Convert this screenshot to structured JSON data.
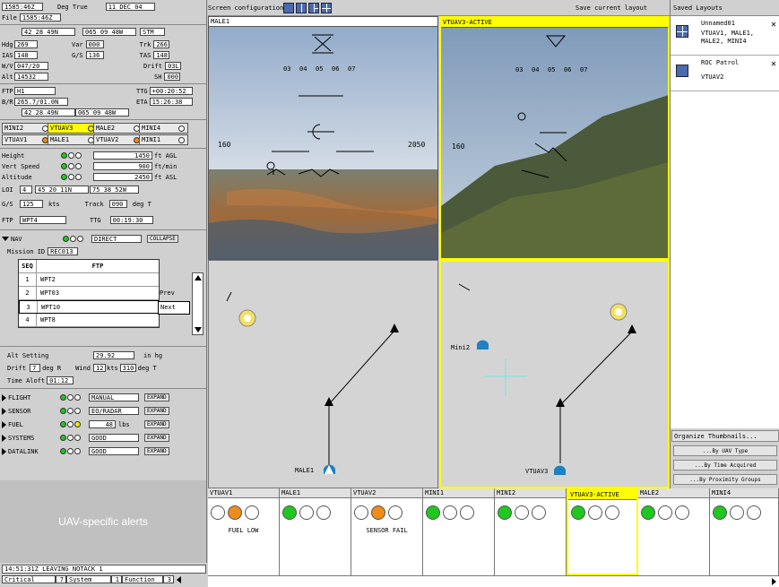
{
  "left": {
    "top_row": {
      "coords": "1585:46Z",
      "deg": "Deg True",
      "date": "11 DEC 04"
    },
    "file": {
      "label": "File",
      "value": "1585:46Z"
    },
    "pos1": {
      "lat": "42 28 49N",
      "lon": "065 09 48W",
      "stm": "STM"
    },
    "hdg": {
      "label": "Hdg",
      "value": "269"
    },
    "var": {
      "label": "Var",
      "value": "000"
    },
    "trk": {
      "label": "Trk",
      "value": "266"
    },
    "ias": {
      "label": "IAS",
      "value": "148"
    },
    "gs": {
      "label": "G/S",
      "value": "136"
    },
    "tas": {
      "label": "TAS",
      "value": "148"
    },
    "wv": {
      "label": "W/V",
      "value": "047/20"
    },
    "drift": {
      "label": "Drift",
      "value": "03L"
    },
    "alt": {
      "label": "Alt",
      "value": "14532"
    },
    "sh": {
      "label": "SH",
      "value": "000"
    },
    "ftp": {
      "label": "FTP",
      "value": "H1"
    },
    "ttg": {
      "label": "TTG",
      "value": "+00:20:52"
    },
    "br": {
      "label": "B/R",
      "value": "265.7/01.0N"
    },
    "eta": {
      "label": "ETA",
      "value": "15:26:38"
    },
    "pos2": {
      "lat": "42 28 49N",
      "lon": "065 09 48W"
    },
    "uavs": [
      {
        "name": "MINI2",
        "sel": false,
        "led": ""
      },
      {
        "name": "VTUAV3",
        "sel": true,
        "led": "y"
      },
      {
        "name": "MALE2",
        "sel": false,
        "led": ""
      },
      {
        "name": "MINI4",
        "sel": false,
        "led": ""
      },
      {
        "name": "VTUAV1",
        "sel": false,
        "led": "o"
      },
      {
        "name": "MALE1",
        "sel": false,
        "led": ""
      },
      {
        "name": "VTUAV2",
        "sel": false,
        "led": "o"
      },
      {
        "name": "MINI1",
        "sel": false,
        "led": ""
      }
    ],
    "height": {
      "label": "Height",
      "value": "1450",
      "unit": "ft AGL"
    },
    "vspeed": {
      "label": "Vert Speed",
      "value": "900",
      "unit": "ft/min"
    },
    "altitude": {
      "label": "Altitude",
      "value": "2450",
      "unit": "ft ASL"
    },
    "loi": {
      "label": "LOI",
      "num": "4",
      "lat": "45 20 11N",
      "lon": "75 38 52W"
    },
    "gs2": {
      "label": "G/S",
      "value": "125",
      "unit": "kts",
      "track_label": "Track",
      "track": "090",
      "track_unit": "deg T"
    },
    "ftp2": {
      "label": "FTP",
      "value": "WPT4",
      "ttg_label": "TTG",
      "ttg": "00:19:30"
    },
    "nav": {
      "label": "NAV",
      "mode": "DIRECT",
      "btn": "COLLAPSE"
    },
    "mission": {
      "label": "Mission ID",
      "value": "REC013"
    },
    "fptable": {
      "hdr_seq": "SEQ",
      "hdr_ftp": "FTP",
      "rows": [
        {
          "seq": "1",
          "wpt": "WPT2",
          "tag": ""
        },
        {
          "seq": "2",
          "wpt": "WPT03",
          "tag": "Prev"
        },
        {
          "seq": "3",
          "wpt": "WPT10",
          "tag": "Next"
        },
        {
          "seq": "4",
          "wpt": "WPT8",
          "tag": ""
        }
      ]
    },
    "altset": {
      "label": "Alt Setting",
      "value": "29.92",
      "unit": "in hg"
    },
    "drift2": {
      "label": "Drift",
      "value": "7",
      "unit": "deg R",
      "wind_label": "Wind",
      "wind": "12",
      "wind_unit": "kts",
      "wind_dir": "310",
      "wind_dir_unit": "deg T"
    },
    "timealoft": {
      "label": "Time Aloft",
      "value": "01:12"
    },
    "systems": [
      {
        "name": "FLIGHT",
        "value": "MANUAL",
        "unit": "",
        "leds": [
          "g",
          "",
          ""
        ],
        "btn": "EXPAND"
      },
      {
        "name": "SENSOR",
        "value": "EO/RADAR",
        "unit": "",
        "leds": [
          "g",
          "",
          ""
        ],
        "btn": "EXPAND"
      },
      {
        "name": "FUEL",
        "value": "48",
        "unit": "lbs",
        "leds": [
          "g",
          "",
          "y"
        ],
        "btn": "EXPAND"
      },
      {
        "name": "SYSTEMS",
        "value": "GOOD",
        "unit": "",
        "leds": [
          "g",
          "",
          ""
        ],
        "btn": "EXPAND"
      },
      {
        "name": "DATALINK",
        "value": "GOOD",
        "unit": "",
        "leds": [
          "g",
          "",
          ""
        ],
        "btn": "EXPAND"
      }
    ],
    "alerts_label": "UAV-specific alerts",
    "status_msg": "14:51:31Z LEAVING NOTACK 1",
    "counts": {
      "critical_label": "Critical",
      "critical": "7",
      "system_label": "System",
      "system": "1",
      "function_label": "Function",
      "function": "3"
    }
  },
  "top": {
    "screen_config": "Screen configuration:",
    "save_layout": "Save current layout"
  },
  "views": {
    "male1": "MALE1",
    "vtuav3": "VTUAV3-ACTIVE",
    "hud": {
      "heads": [
        "03",
        "04",
        "05",
        "06",
        "07"
      ],
      "speed": "160",
      "alt": "2050"
    },
    "map_labels": {
      "mini2": "Mini2",
      "male1": "MALE1",
      "vtuav3": "VTUAV3"
    }
  },
  "right": {
    "title": "Saved Layouts",
    "layouts": [
      {
        "name": "Unnamed01",
        "desc": "VTUAV1, MALE1, MALE2, MINI4"
      },
      {
        "name": "ROC Patrol",
        "desc": "VTUAV2"
      }
    ],
    "organize": "Organize Thumbnails...",
    "by_type": "...By UAV Type",
    "by_time": "...By Time Acquired",
    "by_prox": "...By Proximity Groups"
  },
  "thumbs": [
    {
      "name": "VTUAV1",
      "leds": [
        "",
        "o",
        ""
      ],
      "msg": "FUEL LOW"
    },
    {
      "name": "MALE1",
      "leds": [
        "g",
        "",
        ""
      ],
      "msg": ""
    },
    {
      "name": "VTUAV2",
      "leds": [
        "",
        "o",
        ""
      ],
      "msg": "SENSOR FAIL"
    },
    {
      "name": "MINI1",
      "leds": [
        "g",
        "",
        ""
      ],
      "msg": ""
    },
    {
      "name": "MINI2",
      "leds": [
        "g",
        "",
        ""
      ],
      "msg": ""
    },
    {
      "name": "VTUAV3-ACTIVE",
      "leds": [
        "g",
        "",
        ""
      ],
      "msg": "",
      "active": true
    },
    {
      "name": "MALE2",
      "leds": [
        "g",
        "",
        ""
      ],
      "msg": ""
    },
    {
      "name": "MINI4",
      "leds": [
        "g",
        "",
        ""
      ],
      "msg": ""
    }
  ]
}
